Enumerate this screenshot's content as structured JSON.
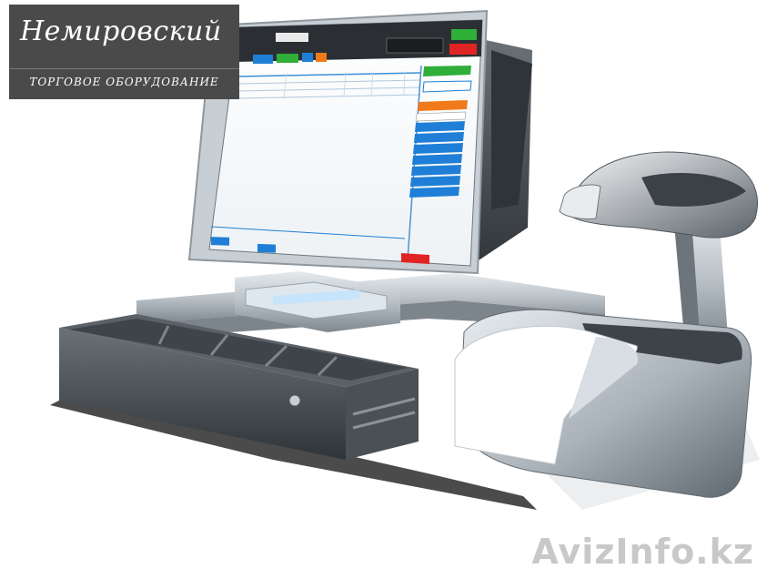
{
  "logo": {
    "title": "Немировский",
    "subtitle": "ТОРГОВОЕ ОБОРУДОВАНИЕ"
  },
  "watermark": {
    "text": "AvizInfo.kz"
  },
  "screen": {
    "header_button_labels": [
      "",
      "",
      "",
      ""
    ],
    "side_buttons": [
      "",
      "",
      "",
      "",
      "",
      "",
      "",
      "",
      "",
      "",
      ""
    ],
    "pay_button_label": ""
  },
  "colors": {
    "logo_bg": "#4a4a4a",
    "screen_accent_blue": "#1f7fd6",
    "screen_green": "#2fae3a",
    "screen_orange": "#f07a1a",
    "screen_red": "#e02424",
    "device_metal": "#9aa3aa",
    "device_dark": "#3a3f44"
  }
}
